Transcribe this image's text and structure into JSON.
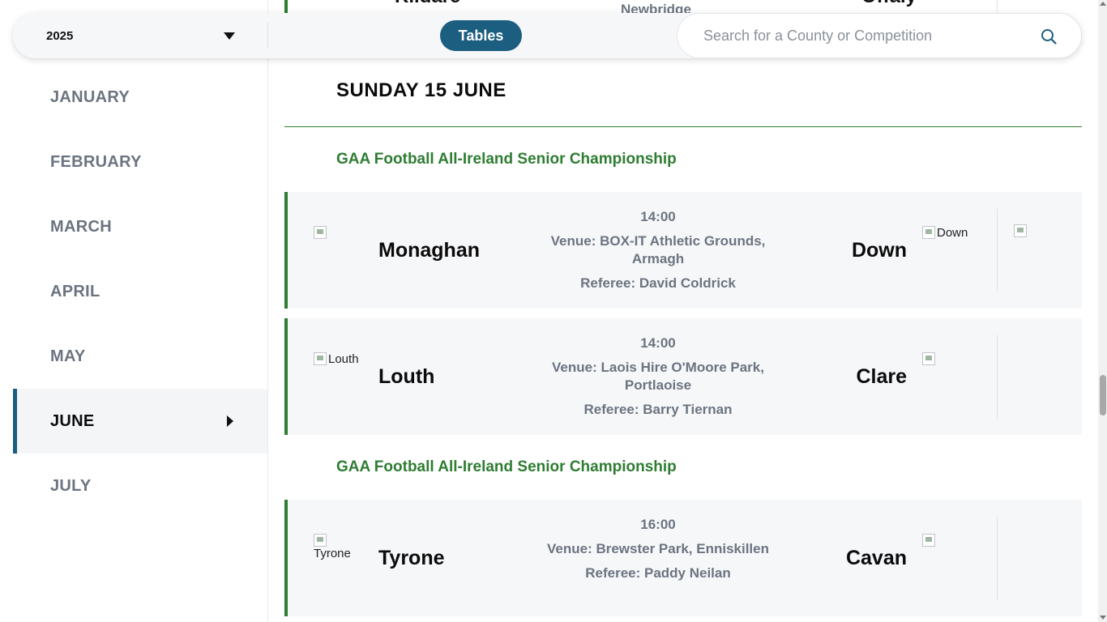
{
  "header": {
    "year": "2025",
    "tables_label": "Tables",
    "search_placeholder": "Search for a County or Competition",
    "search_value": ""
  },
  "sidebar": {
    "months": [
      {
        "label": "JANUARY",
        "active": false
      },
      {
        "label": "FEBRUARY",
        "active": false
      },
      {
        "label": "MARCH",
        "active": false
      },
      {
        "label": "APRIL",
        "active": false
      },
      {
        "label": "MAY",
        "active": false
      },
      {
        "label": "JUNE",
        "active": true
      },
      {
        "label": "JULY",
        "active": false
      }
    ]
  },
  "previous_fixture_partial": {
    "home": "Kildare",
    "venue_fragment": "Newbridge",
    "away": "Offaly"
  },
  "day": {
    "heading": "SUNDAY 15 JUNE"
  },
  "groups": [
    {
      "competition": "GAA Football All-Ireland Senior Championship",
      "fixtures": [
        {
          "home": "Monaghan",
          "home_crest_alt": "",
          "away": "Down",
          "away_crest_alt": "Down",
          "time": "14:00",
          "venue": "Venue: BOX-IT Athletic Grounds, Armagh",
          "referee": "Referee: David Coldrick",
          "extra_icon": true
        },
        {
          "home": "Louth",
          "home_crest_alt": "Louth",
          "away": "Clare",
          "away_crest_alt": "",
          "time": "14:00",
          "venue": "Venue: Laois Hire O'Moore Park, Portlaoise",
          "referee": "Referee: Barry Tiernan",
          "extra_icon": false
        }
      ]
    },
    {
      "competition": "GAA Football All-Ireland Senior Championship",
      "fixtures": [
        {
          "home": "Tyrone",
          "home_crest_alt": "Tyrone",
          "away": "Cavan",
          "away_crest_alt": "",
          "time": "16:00",
          "venue": "Venue: Brewster Park, Enniskillen",
          "referee": "Referee: Paddy Neilan",
          "extra_icon": false
        }
      ]
    }
  ],
  "colors": {
    "accent_blue": "#1b5e80",
    "competition_green": "#2e7d32",
    "muted_text": "#6b7480"
  }
}
